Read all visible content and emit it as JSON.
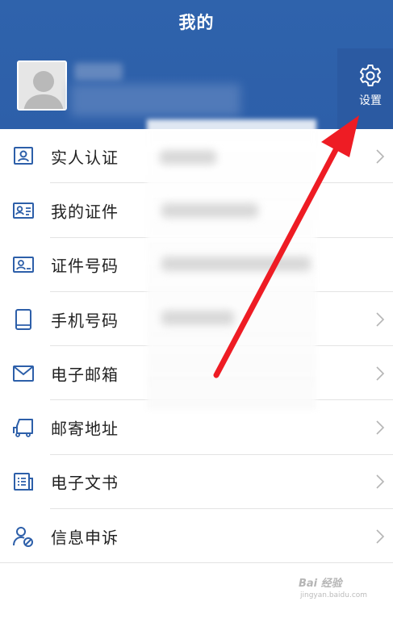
{
  "header": {
    "title": "我的"
  },
  "settings": {
    "label": "设置",
    "icon": "gear-icon"
  },
  "menu": [
    {
      "label": "实人认证",
      "icon": "id-person-icon",
      "chevron": true
    },
    {
      "label": "我的证件",
      "icon": "id-card-icon",
      "chevron": false
    },
    {
      "label": "证件号码",
      "icon": "id-number-icon",
      "chevron": false
    },
    {
      "label": "手机号码",
      "icon": "phone-icon",
      "chevron": true
    },
    {
      "label": "电子邮箱",
      "icon": "mail-icon",
      "chevron": true
    },
    {
      "label": "邮寄地址",
      "icon": "truck-icon",
      "chevron": true
    },
    {
      "label": "电子文书",
      "icon": "document-icon",
      "chevron": true
    },
    {
      "label": "信息申诉",
      "icon": "user-appeal-icon",
      "chevron": true
    }
  ],
  "watermark": {
    "text": "Bai 经验",
    "sub": "jingyan.baidu.com"
  },
  "colors": {
    "header": "#2f63ac",
    "icon": "#2d5fa9",
    "arrow": "#ee1c24"
  }
}
